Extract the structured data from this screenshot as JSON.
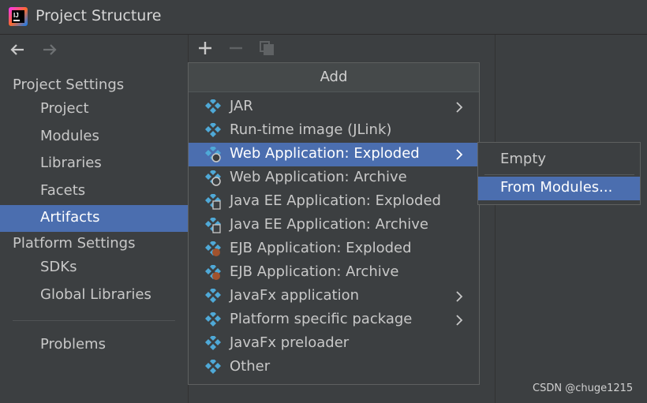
{
  "window": {
    "title": "Project Structure",
    "logo_text": "IJ"
  },
  "sidebar": {
    "project_settings_header": "Project Settings",
    "project_items": [
      {
        "label": "Project"
      },
      {
        "label": "Modules"
      },
      {
        "label": "Libraries"
      },
      {
        "label": "Facets"
      },
      {
        "label": "Artifacts",
        "selected": true
      }
    ],
    "platform_settings_header": "Platform Settings",
    "platform_items": [
      {
        "label": "SDKs"
      },
      {
        "label": "Global Libraries"
      }
    ],
    "problems_label": "Problems"
  },
  "toolbar": {
    "icons": [
      "plus-icon",
      "minus-icon",
      "copy-icon"
    ]
  },
  "add_popup": {
    "title": "Add",
    "items": [
      {
        "label": "JAR",
        "icon": "jar-icon",
        "has_submenu": true
      },
      {
        "label": "Run-time image (JLink)",
        "icon": "jlink-icon",
        "has_submenu": false
      },
      {
        "label": "Web Application: Exploded",
        "icon": "web-exploded-icon",
        "has_submenu": true,
        "selected": true
      },
      {
        "label": "Web Application: Archive",
        "icon": "web-archive-icon",
        "has_submenu": false
      },
      {
        "label": "Java EE Application: Exploded",
        "icon": "javaee-exploded-icon",
        "has_submenu": false
      },
      {
        "label": "Java EE Application: Archive",
        "icon": "javaee-archive-icon",
        "has_submenu": false
      },
      {
        "label": "EJB Application: Exploded",
        "icon": "ejb-exploded-icon",
        "has_submenu": false
      },
      {
        "label": "EJB Application: Archive",
        "icon": "ejb-archive-icon",
        "has_submenu": false
      },
      {
        "label": "JavaFx application",
        "icon": "javafx-icon",
        "has_submenu": true
      },
      {
        "label": "Platform specific package",
        "icon": "package-icon",
        "has_submenu": true
      },
      {
        "label": "JavaFx preloader",
        "icon": "preloader-icon",
        "has_submenu": false
      },
      {
        "label": "Other",
        "icon": "other-icon",
        "has_submenu": false
      }
    ]
  },
  "submenu": {
    "items": [
      {
        "label": "Empty"
      },
      {
        "label": "From Modules...",
        "selected": true
      }
    ]
  },
  "watermark": "CSDN @chuge1215",
  "colors": {
    "background": "#3c3f41",
    "selection": "#4b6eaf",
    "text": "#c8c8c8",
    "artifact_blue": "#4fa9d7"
  }
}
